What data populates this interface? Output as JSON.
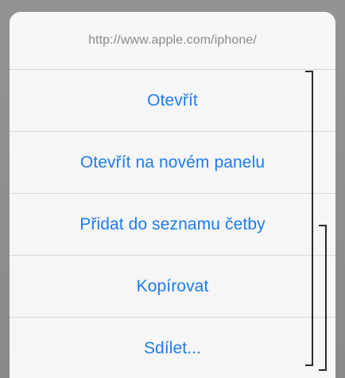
{
  "sheet": {
    "url": "http://www.apple.com/iphone/",
    "actions": [
      {
        "label": "Otevřít"
      },
      {
        "label": "Otevřít na novém panelu"
      },
      {
        "label": "Přidat do seznamu četby"
      },
      {
        "label": "Kopírovat"
      },
      {
        "label": "Sdílet..."
      }
    ]
  },
  "colors": {
    "action_text": "#1d7bef",
    "url_text": "#8a8a8a",
    "sheet_bg": "#f5f5f5",
    "backdrop": "#8e8e8e"
  }
}
